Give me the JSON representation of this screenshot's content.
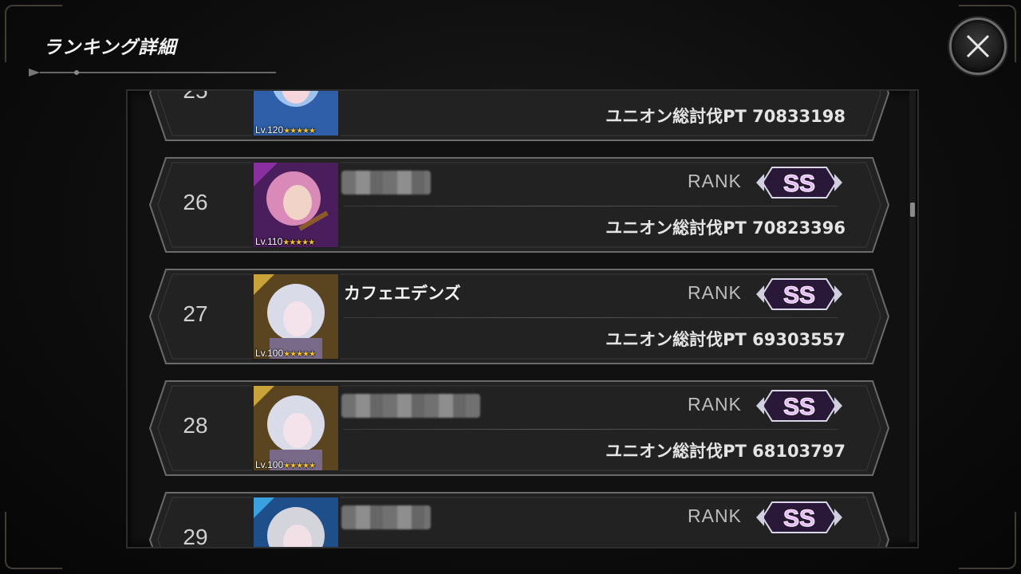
{
  "header": {
    "title": "ランキング詳細"
  },
  "rows": [
    {
      "rank": "25",
      "name": "",
      "name_blurred": true,
      "level": "Lv.120",
      "stars": "★★★★★",
      "rank_label": "",
      "rank_grade": "",
      "score": "ユニオン総討伐PT 70833198"
    },
    {
      "rank": "26",
      "name": "",
      "name_blurred": true,
      "level": "Lv.110",
      "stars": "★★★★★",
      "rank_label": "RANK",
      "rank_grade": "SS",
      "score": "ユニオン総討伐PT 70823396"
    },
    {
      "rank": "27",
      "name": "カフェエデンズ",
      "name_blurred": false,
      "level": "Lv.100",
      "stars": "★★★★★",
      "rank_label": "RANK",
      "rank_grade": "SS",
      "score": "ユニオン総討伐PT 69303557"
    },
    {
      "rank": "28",
      "name": "",
      "name_blurred": true,
      "level": "Lv.100",
      "stars": "★★★★★",
      "rank_label": "RANK",
      "rank_grade": "SS",
      "score": "ユニオン総討伐PT 68103797"
    },
    {
      "rank": "29",
      "name": "",
      "name_blurred": true,
      "level": "",
      "stars": "",
      "rank_label": "RANK",
      "rank_grade": "SS",
      "score": ""
    }
  ],
  "colors": {
    "accent_frame": "#5a5348",
    "badge_ss": "#c77dff",
    "star": "#f2c230"
  },
  "icons": {
    "close": "close-icon"
  }
}
